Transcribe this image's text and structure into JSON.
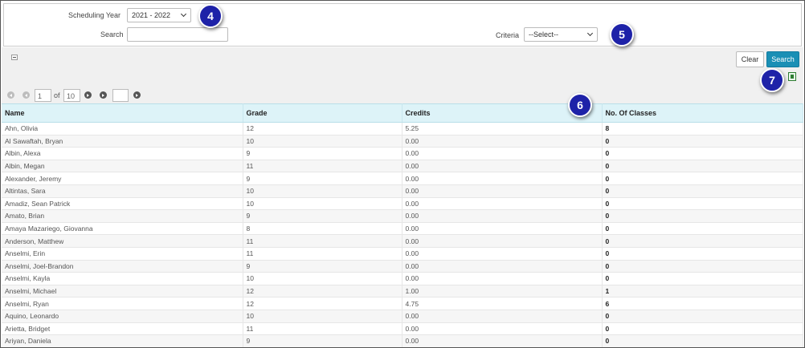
{
  "filters": {
    "year_label": "Scheduling Year",
    "year_value": "2021 - 2022",
    "search_label": "Search",
    "search_value": "",
    "criteria_label": "Criteria",
    "criteria_value": "--Select--"
  },
  "callouts": [
    "4",
    "5",
    "6",
    "7"
  ],
  "actions": {
    "clear": "Clear",
    "search": "Search"
  },
  "pager": {
    "page": "1",
    "of": "of",
    "total": "10",
    "jump_value": ""
  },
  "table": {
    "columns": [
      "Name",
      "Grade",
      "Credits",
      "No. Of Classes"
    ],
    "rows": [
      [
        "Ahn, Olivia",
        "12",
        "5.25",
        "8"
      ],
      [
        "Al Sawaftah, Bryan",
        "10",
        "0.00",
        "0"
      ],
      [
        "Albin, Alexa",
        "9",
        "0.00",
        "0"
      ],
      [
        "Albin, Megan",
        "11",
        "0.00",
        "0"
      ],
      [
        "Alexander, Jeremy",
        "9",
        "0.00",
        "0"
      ],
      [
        "Altintas, Sara",
        "10",
        "0.00",
        "0"
      ],
      [
        "Amadiz, Sean Patrick",
        "10",
        "0.00",
        "0"
      ],
      [
        "Amato, Brian",
        "9",
        "0.00",
        "0"
      ],
      [
        "Amaya Mazariego, Giovanna",
        "8",
        "0.00",
        "0"
      ],
      [
        "Anderson, Matthew",
        "11",
        "0.00",
        "0"
      ],
      [
        "Anselmi, Erin",
        "11",
        "0.00",
        "0"
      ],
      [
        "Anselmi, Joel-Brandon",
        "9",
        "0.00",
        "0"
      ],
      [
        "Anselmi, Kayla",
        "10",
        "0.00",
        "0"
      ],
      [
        "Anselmi, Michael",
        "12",
        "1.00",
        "1"
      ],
      [
        "Anselmi, Ryan",
        "12",
        "4.75",
        "6"
      ],
      [
        "Aquino, Leonardo",
        "10",
        "0.00",
        "0"
      ],
      [
        "Arietta, Bridget",
        "11",
        "0.00",
        "0"
      ],
      [
        "Ariyan, Daniela",
        "9",
        "0.00",
        "0"
      ]
    ]
  },
  "icons": {
    "collapse": "collapse-icon",
    "export": "excel-export-icon",
    "pager": [
      "first-page-icon",
      "prev-page-icon",
      "next-page-icon",
      "last-page-icon",
      "go-page-icon"
    ],
    "dropdown": "chevron-down-icon"
  },
  "colors": {
    "accent": "#1a8fb5",
    "header_bg": "#ddf3f8",
    "callout": "#1e22a8"
  }
}
